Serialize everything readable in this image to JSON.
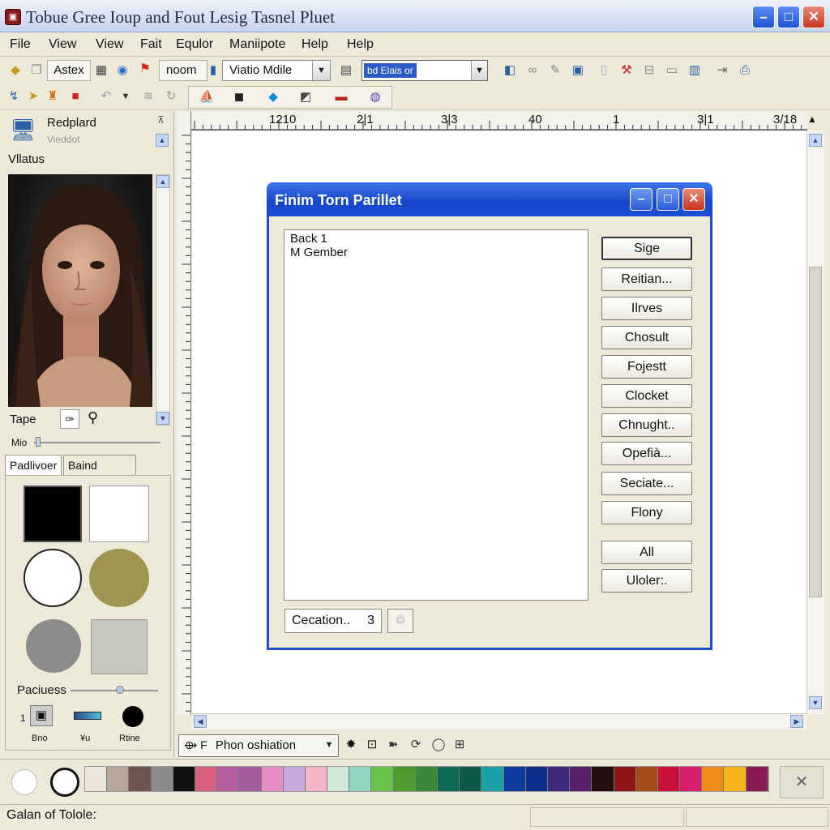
{
  "window": {
    "title": "Tobue Gree Ioup and Fout Lesig Tasnel Pluet"
  },
  "menu": [
    "File",
    "View",
    "View",
    "Fait",
    "Equlor",
    "Maniipote",
    "Help",
    "Help"
  ],
  "toolbar": {
    "aster_label": "Astex",
    "noom_label": "noom",
    "mode_select": "Viatio Mdile",
    "highlight_text": "bd Elais or"
  },
  "left_panel": {
    "header_title": "Redplard",
    "header_sub": "Vieddot",
    "section_label": "Vllatus",
    "tape_label": "Tape",
    "mio_label": "Mio",
    "tabs": [
      "Padlivoer",
      "Baind Insiwn"
    ],
    "paciuess_label": "Paciuess",
    "bottom_labels": [
      "Bno",
      "¥u",
      "Rtine"
    ],
    "bottom_number": "1"
  },
  "ruler_h_labels": [
    "1210",
    "2|1",
    "3|3",
    "40",
    "1",
    "3|1",
    "3/18"
  ],
  "dialog": {
    "title": "Finim Torn Parillet",
    "list_items": [
      "Back 1",
      "M Gember"
    ],
    "buttons": [
      "Sige",
      "Reitian...",
      "Ilrves",
      "Chosult",
      "Fojestt",
      "Clocket",
      "Chnught..",
      "Opefià...",
      "Seciate...",
      "Flony",
      "All",
      "Uloler:."
    ],
    "status_field": "Cecation..",
    "status_value": "3"
  },
  "bottom_toolbar": {
    "select_label": "Phon oshiation"
  },
  "palette_colors": [
    "#ebe6d9",
    "#b8a798",
    "#6e574e",
    "#8a8a8a",
    "#111111",
    "#d9607e",
    "#b45ea0",
    "#a35c9d",
    "#e48ec3",
    "#c7a9dc",
    "#f2b6c8",
    "#cfe8d8",
    "#8fd6c0",
    "#66c24a",
    "#4e9b2f",
    "#3a8a3c",
    "#0f6b56",
    "#0c5a48",
    "#1aa0a6",
    "#0d3c9e",
    "#0f2f8f",
    "#3c2a7a",
    "#5a1f6b",
    "#241010",
    "#8c1414",
    "#a64b1c",
    "#c8103a",
    "#d61f6a",
    "#f08c1c",
    "#f5b41c",
    "#8a1a52"
  ],
  "statusbar": {
    "text": "Galan of Tolole:"
  }
}
